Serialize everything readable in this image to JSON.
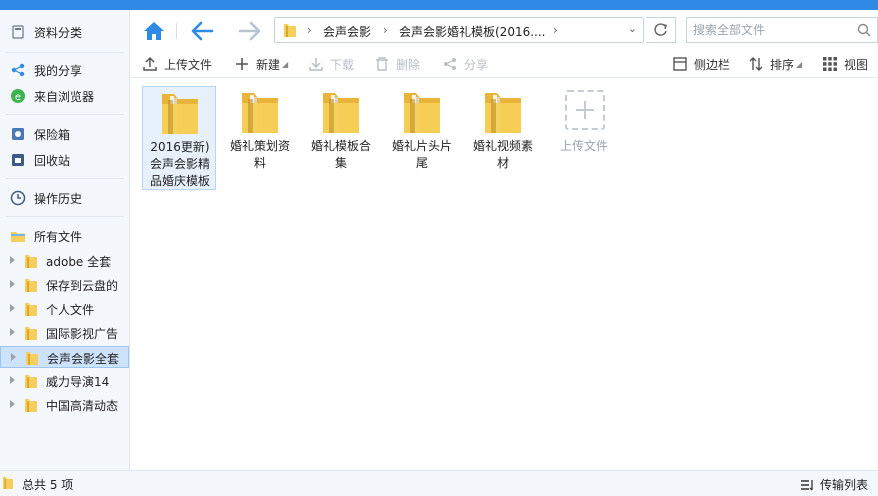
{
  "sidebar": {
    "top_items": [
      {
        "label": "资料分类",
        "icon": "category-icon"
      },
      {
        "label": "我的分享",
        "icon": "share-icon"
      },
      {
        "label": "来自浏览器",
        "icon": "browser-icon"
      },
      {
        "label": "保险箱",
        "icon": "safe-icon"
      },
      {
        "label": "回收站",
        "icon": "trash-icon"
      },
      {
        "label": "操作历史",
        "icon": "history-icon"
      },
      {
        "label": "所有文件",
        "icon": "all-files-icon"
      }
    ],
    "tree": [
      {
        "label": "adobe 全套"
      },
      {
        "label": "保存到云盘的"
      },
      {
        "label": "个人文件"
      },
      {
        "label": "国际影视广告"
      },
      {
        "label": "会声会影全套",
        "selected": true
      },
      {
        "label": "威力导演14"
      },
      {
        "label": "中国高清动态"
      }
    ]
  },
  "nav": {
    "breadcrumb": [
      "会声会影",
      "会声会影婚礼模板(2016...."
    ],
    "search_placeholder": "搜索全部文件"
  },
  "toolbar": {
    "upload": "上传文件",
    "new": "新建",
    "download": "下载",
    "delete": "删除",
    "share": "分享",
    "sidebar": "侧边栏",
    "sort": "排序",
    "view": "视图"
  },
  "files": [
    {
      "name": "2016更新)会声会影精品婚庆模板",
      "selected": true
    },
    {
      "name": "婚礼策划资料"
    },
    {
      "name": "婚礼模板合集"
    },
    {
      "name": "婚礼片头片尾"
    },
    {
      "name": "婚礼视频素材"
    }
  ],
  "upload_tile": {
    "label": "上传文件"
  },
  "status": {
    "count": "总共 5 项",
    "transfer": "传输列表"
  },
  "colors": {
    "accent": "#2f8ae6",
    "folder": "#f5cf5e",
    "selected_bg": "#cde3fb"
  }
}
